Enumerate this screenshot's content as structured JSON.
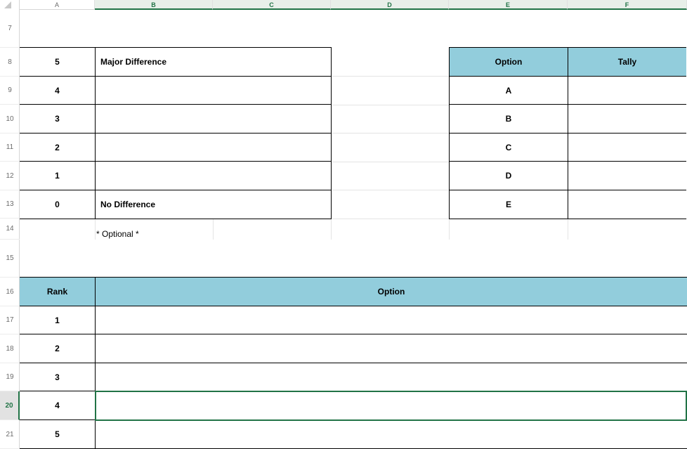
{
  "sheet": {
    "columns": [
      "A",
      "B",
      "C",
      "D",
      "E",
      "F"
    ],
    "rows": [
      "7",
      "8",
      "9",
      "10",
      "11",
      "12",
      "13",
      "14",
      "15",
      "16",
      "17",
      "18",
      "19",
      "20",
      "21"
    ],
    "active_cell": "B20"
  },
  "scale_table": {
    "rows": [
      {
        "score": "5",
        "label": "Major Difference"
      },
      {
        "score": "4",
        "label": ""
      },
      {
        "score": "3",
        "label": ""
      },
      {
        "score": "2",
        "label": ""
      },
      {
        "score": "1",
        "label": ""
      },
      {
        "score": "0",
        "label": "No Difference"
      }
    ],
    "note": "* Optional *"
  },
  "tally_table": {
    "headers": {
      "option": "Option",
      "tally": "Tally"
    },
    "rows": [
      {
        "option": "A",
        "tally": ""
      },
      {
        "option": "B",
        "tally": ""
      },
      {
        "option": "C",
        "tally": ""
      },
      {
        "option": "D",
        "tally": ""
      },
      {
        "option": "E",
        "tally": ""
      }
    ]
  },
  "rank_table": {
    "headers": {
      "rank": "Rank",
      "option": "Option"
    },
    "rows": [
      {
        "rank": "1",
        "option": ""
      },
      {
        "rank": "2",
        "option": ""
      },
      {
        "rank": "3",
        "option": ""
      },
      {
        "rank": "4",
        "option": ""
      },
      {
        "rank": "5",
        "option": ""
      }
    ]
  },
  "colors": {
    "header_fill": "#92cddc",
    "selection_green": "#217346"
  }
}
